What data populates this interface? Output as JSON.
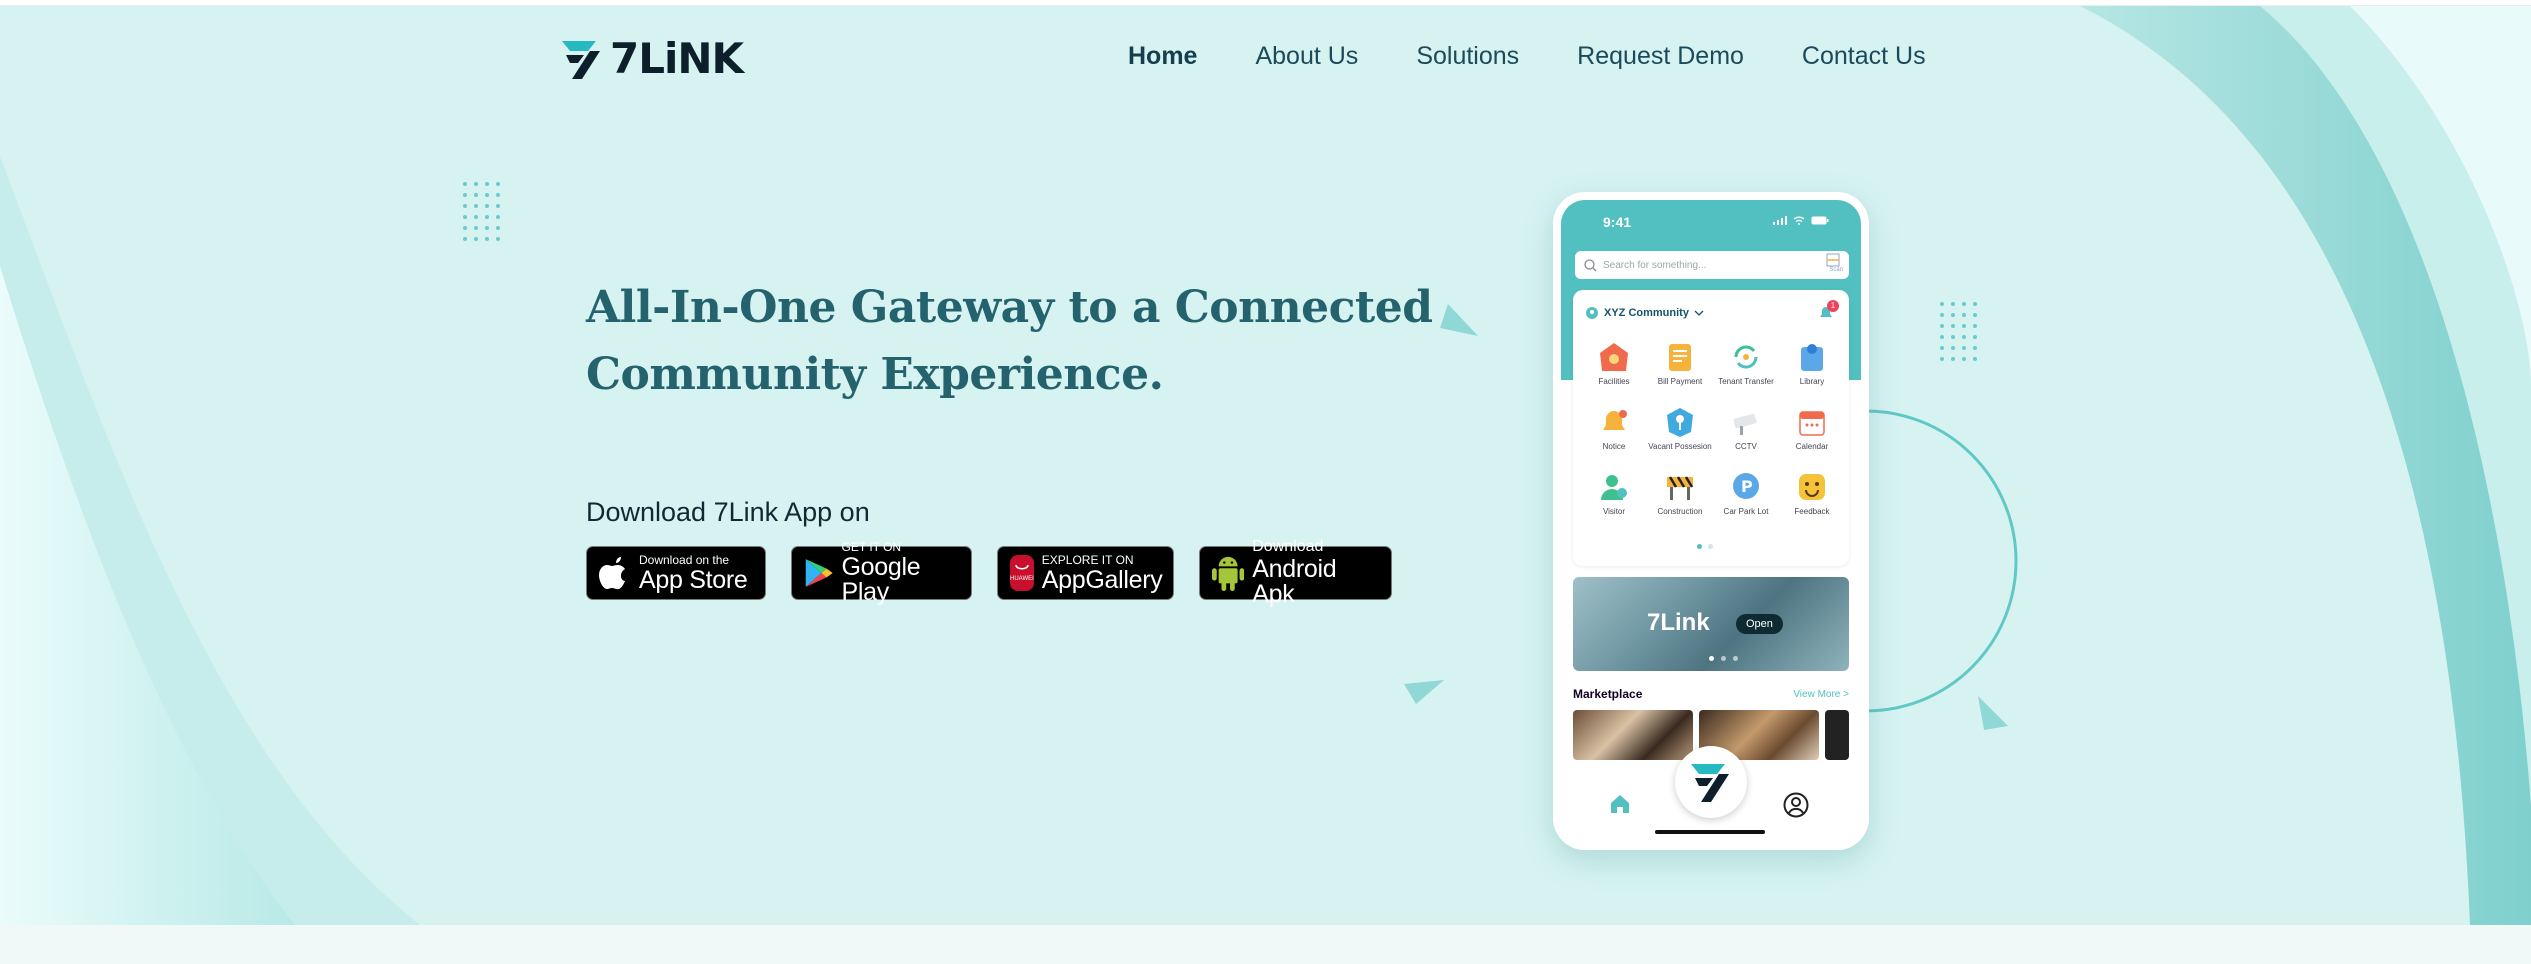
{
  "brand": {
    "name": "7LiNK",
    "accent": "#27b9c2",
    "dark": "#0d1f2b"
  },
  "nav": {
    "items": [
      {
        "label": "Home",
        "active": true
      },
      {
        "label": "About Us"
      },
      {
        "label": "Solutions"
      },
      {
        "label": "Request Demo"
      },
      {
        "label": "Contact Us"
      }
    ]
  },
  "hero": {
    "headline": "All-In-One Gateway to a Connected Community Experience.",
    "download_title": "Download 7Link App on"
  },
  "badges": {
    "appstore": {
      "small": "Download on the",
      "big": "App Store",
      "icon": "apple-icon"
    },
    "googleplay": {
      "small": "GET IT ON",
      "big": "Google Play",
      "icon": "google-play-icon"
    },
    "appgallery": {
      "small": "EXPLORE IT ON",
      "big": "AppGallery",
      "icon": "huawei-icon",
      "icon_text": "HUAWEI"
    },
    "android": {
      "small": "Download",
      "big": "Android Apk",
      "icon": "android-icon"
    }
  },
  "phone": {
    "time": "9:41",
    "search_placeholder": "Search for something...",
    "scan": "Scan",
    "community": "XYZ Community",
    "notification_count": "1",
    "services": [
      {
        "label": "Facilities",
        "icon": "facilities-icon"
      },
      {
        "label": "Bill Payment",
        "icon": "bill-icon"
      },
      {
        "label": "Tenant Transfer",
        "icon": "transfer-icon"
      },
      {
        "label": "Library",
        "icon": "library-icon"
      },
      {
        "label": "Notice",
        "icon": "bell-icon"
      },
      {
        "label": "Vacant Possesion",
        "icon": "key-icon"
      },
      {
        "label": "CCTV",
        "icon": "cctv-icon"
      },
      {
        "label": "Calendar",
        "icon": "calendar-icon"
      },
      {
        "label": "Visitor",
        "icon": "visitor-icon"
      },
      {
        "label": "Construction",
        "icon": "construction-icon"
      },
      {
        "label": "Car Park Lot",
        "icon": "parking-icon"
      },
      {
        "label": "Feedback",
        "icon": "smile-icon"
      }
    ],
    "banner_title": "7Link",
    "banner_button": "Open",
    "marketplace_title": "Marketplace",
    "view_more": "View More >"
  }
}
